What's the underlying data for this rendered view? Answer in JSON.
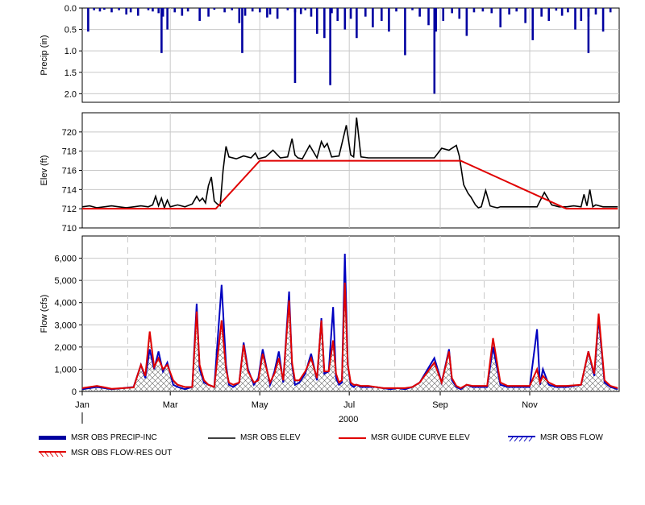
{
  "chart_data": [
    {
      "type": "bar",
      "panel": "precip",
      "ylabel": "Precip (in)",
      "ylim": [
        0,
        2.2
      ],
      "y_inverted": true,
      "yticks": [
        "0.0",
        "0.5",
        "1.0",
        "1.5",
        "2.0"
      ],
      "yticks_values": [
        0,
        0.5,
        1.0,
        1.5,
        2.0
      ],
      "series": [
        {
          "name": "MSR OBS PRECIP-INC",
          "color": "#0000a0",
          "x_day": [
            4,
            8,
            12,
            15,
            20,
            25,
            30,
            33,
            38,
            45,
            48,
            52,
            55,
            58,
            63,
            68,
            72,
            80,
            86,
            90,
            97,
            102,
            107,
            111,
            116,
            121,
            126,
            128,
            133,
            140,
            145,
            149,
            152,
            156,
            160,
            165,
            170,
            174,
            179,
            183,
            187,
            193,
            198,
            204,
            209,
            214,
            220,
            225,
            230,
            236,
            241,
            246,
            252,
            257,
            262,
            267,
            273,
            279,
            285,
            291,
            296,
            302,
            307,
            313,
            318,
            323,
            327,
            331,
            336,
            340,
            345,
            350,
            355,
            360
          ],
          "values": [
            0.55,
            0.05,
            0.08,
            0.04,
            0.1,
            0.05,
            0.15,
            0.1,
            0.18,
            0.05,
            0.08,
            0.12,
            0.2,
            0.5,
            0.1,
            0.18,
            0.08,
            0.3,
            0.2,
            0.04,
            0.1,
            0.05,
            0.35,
            0.18,
            0.08,
            0.1,
            0.22,
            0.15,
            0.25,
            0.05,
            0.1,
            0.14,
            0.05,
            0.2,
            0.6,
            0.7,
            0.12,
            0.3,
            0.5,
            0.25,
            0.7,
            0.2,
            0.45,
            0.3,
            0.55,
            0.08,
            1.1,
            0.05,
            0.2,
            0.4,
            0.55,
            0.3,
            0.12,
            0.25,
            0.65,
            0.1,
            0.08,
            0.12,
            0.45,
            0.15,
            0.08,
            0.35,
            0.75,
            0.2,
            0.3,
            0.06,
            0.18,
            0.1,
            0.5,
            0.3,
            0.2,
            0.15,
            0.55,
            0.1
          ]
        }
      ],
      "extra_bars": [
        {
          "x_day": 54,
          "value": 1.05
        },
        {
          "x_day": 109,
          "value": 1.05
        },
        {
          "x_day": 145,
          "value": 1.75
        },
        {
          "x_day": 169,
          "value": 1.8
        },
        {
          "x_day": 240,
          "value": 2.0
        },
        {
          "x_day": 345,
          "value": 1.05
        }
      ]
    },
    {
      "type": "line",
      "panel": "elev",
      "ylabel": "Elev (ft)",
      "ylim": [
        710,
        722
      ],
      "yticks": [
        "710",
        "712",
        "714",
        "716",
        "718",
        "720"
      ],
      "yticks_values": [
        710,
        712,
        714,
        716,
        718,
        720
      ],
      "series": [
        {
          "name": "MSR OBS ELEV",
          "color": "#000000",
          "x": [
            0,
            5,
            10,
            15,
            20,
            25,
            30,
            35,
            40,
            45,
            48,
            50,
            52,
            54,
            56,
            58,
            60,
            65,
            70,
            75,
            78,
            80,
            82,
            84,
            86,
            88,
            90,
            92,
            94,
            96,
            98,
            100,
            105,
            110,
            115,
            118,
            120,
            125,
            130,
            135,
            140,
            143,
            145,
            147,
            150,
            155,
            160,
            163,
            165,
            167,
            170,
            175,
            180,
            183,
            185,
            187,
            190,
            195,
            200,
            205,
            210,
            215,
            220,
            225,
            230,
            235,
            240,
            245,
            250,
            255,
            257,
            260,
            263,
            265,
            268,
            270,
            272,
            275,
            278,
            280,
            283,
            285,
            290,
            300,
            310,
            315,
            320,
            325,
            330,
            335,
            340,
            342,
            344,
            346,
            348,
            350,
            355,
            360,
            365
          ],
          "y": [
            712.2,
            712.3,
            712.1,
            712.2,
            712.3,
            712.2,
            712.1,
            712.2,
            712.3,
            712.2,
            712.4,
            713.3,
            712.3,
            713.1,
            712.1,
            712.9,
            712.2,
            712.4,
            712.2,
            712.5,
            713.3,
            712.8,
            713.1,
            712.6,
            714.4,
            715.3,
            712.8,
            712.5,
            712.3,
            716.0,
            718.5,
            717.4,
            717.2,
            717.5,
            717.3,
            717.8,
            717.2,
            717.4,
            718.1,
            717.3,
            717.4,
            719.3,
            717.6,
            717.3,
            717.2,
            718.6,
            717.3,
            719.0,
            718.4,
            718.8,
            717.4,
            717.5,
            720.7,
            717.6,
            717.4,
            721.5,
            717.4,
            717.3,
            717.3,
            717.3,
            717.3,
            717.3,
            717.3,
            717.3,
            717.3,
            717.3,
            717.3,
            718.3,
            718.1,
            718.6,
            717.5,
            714.5,
            713.6,
            713.2,
            712.4,
            712.1,
            712.2,
            713.9,
            712.3,
            712.2,
            712.1,
            712.2,
            712.2,
            712.2,
            712.2,
            713.7,
            712.4,
            712.2,
            712.2,
            712.3,
            712.2,
            713.5,
            712.3,
            714.0,
            712.2,
            712.4,
            712.2,
            712.2,
            712.2
          ],
          "x_unit": "day of year 2000"
        },
        {
          "name": "MSR GUIDE CURVE ELEV",
          "color": "#e00000",
          "x": [
            0,
            91,
            121,
            258,
            330,
            365
          ],
          "y": [
            712,
            712,
            717,
            717,
            712,
            712
          ]
        }
      ]
    },
    {
      "type": "area",
      "panel": "flow",
      "ylabel": "Flow (cfs)",
      "ylim": [
        0,
        7000
      ],
      "yticks": [
        "0",
        "1,000",
        "2,000",
        "3,000",
        "4,000",
        "5,000",
        "6,000"
      ],
      "yticks_values": [
        0,
        1000,
        2000,
        3000,
        4000,
        5000,
        6000
      ],
      "xlabel": "2000",
      "xticks": [
        "Jan",
        "Mar",
        "May",
        "Jul",
        "Sep",
        "Nov"
      ],
      "xticks_day": [
        0,
        60,
        121,
        182,
        244,
        305
      ],
      "gridline_days": [
        31,
        91,
        152,
        213,
        274,
        335
      ],
      "series": [
        {
          "name": "MSR OBS FLOW",
          "color": "#0000c0",
          "x": [
            0,
            10,
            20,
            28,
            35,
            40,
            43,
            46,
            49,
            52,
            55,
            58,
            62,
            65,
            70,
            75,
            78,
            80,
            83,
            86,
            90,
            95,
            98,
            100,
            103,
            107,
            110,
            113,
            117,
            120,
            123,
            128,
            131,
            134,
            137,
            141,
            143,
            145,
            148,
            152,
            156,
            160,
            163,
            165,
            168,
            171,
            173,
            175,
            177,
            179,
            181,
            183,
            185,
            187,
            190,
            195,
            200,
            205,
            210,
            215,
            220,
            225,
            230,
            240,
            245,
            250,
            252,
            255,
            258,
            262,
            266,
            270,
            276,
            280,
            285,
            290,
            295,
            300,
            305,
            310,
            312,
            314,
            318,
            323,
            330,
            340,
            345,
            349,
            352,
            356,
            360,
            365
          ],
          "y": [
            100,
            200,
            100,
            150,
            200,
            1200,
            600,
            1900,
            1000,
            1800,
            900,
            1300,
            300,
            200,
            100,
            200,
            3950,
            1000,
            400,
            300,
            200,
            4800,
            1200,
            300,
            200,
            400,
            2200,
            1000,
            300,
            600,
            1900,
            300,
            900,
            1800,
            400,
            4500,
            1200,
            300,
            400,
            800,
            1700,
            500,
            3300,
            800,
            900,
            3800,
            600,
            300,
            400,
            6200,
            1200,
            300,
            200,
            300,
            200,
            200,
            200,
            150,
            100,
            150,
            100,
            200,
            400,
            1500,
            400,
            1900,
            500,
            200,
            100,
            300,
            200,
            200,
            200,
            2000,
            300,
            200,
            200,
            200,
            200,
            2800,
            300,
            1000,
            300,
            200,
            200,
            300,
            1800,
            700,
            3300,
            400,
            200,
            100
          ]
        },
        {
          "name": "MSR OBS FLOW-RES OUT",
          "color": "#e00000",
          "x": [
            0,
            10,
            20,
            28,
            35,
            40,
            43,
            46,
            49,
            52,
            55,
            58,
            62,
            65,
            70,
            75,
            78,
            80,
            83,
            86,
            90,
            95,
            98,
            100,
            103,
            107,
            110,
            113,
            117,
            120,
            123,
            128,
            131,
            134,
            137,
            141,
            143,
            145,
            148,
            152,
            156,
            160,
            163,
            165,
            168,
            171,
            173,
            175,
            177,
            179,
            181,
            183,
            185,
            187,
            190,
            195,
            200,
            205,
            210,
            215,
            220,
            225,
            230,
            240,
            245,
            250,
            252,
            255,
            258,
            262,
            266,
            270,
            276,
            280,
            285,
            290,
            295,
            300,
            305,
            310,
            312,
            314,
            318,
            323,
            330,
            340,
            345,
            349,
            352,
            356,
            360,
            365
          ],
          "y": [
            150,
            250,
            120,
            150,
            180,
            1200,
            700,
            2700,
            1100,
            1500,
            1000,
            1200,
            500,
            300,
            200,
            200,
            3600,
            1200,
            500,
            300,
            200,
            3200,
            1000,
            400,
            300,
            400,
            2100,
            900,
            400,
            500,
            1700,
            400,
            800,
            1500,
            500,
            4100,
            1300,
            500,
            500,
            900,
            1500,
            600,
            3200,
            900,
            900,
            2300,
            800,
            400,
            500,
            4900,
            1200,
            400,
            300,
            300,
            250,
            250,
            200,
            150,
            150,
            150,
            150,
            200,
            400,
            1300,
            400,
            1800,
            600,
            250,
            150,
            300,
            250,
            250,
            250,
            2400,
            400,
            250,
            250,
            250,
            250,
            1000,
            400,
            700,
            400,
            250,
            250,
            300,
            1800,
            800,
            3500,
            500,
            250,
            150
          ]
        }
      ]
    }
  ],
  "legend": [
    {
      "label": "MSR OBS PRECIP-INC",
      "style": "thick-bar",
      "color": "#0000a0"
    },
    {
      "label": "MSR OBS ELEV",
      "style": "line",
      "color": "#000000"
    },
    {
      "label": "MSR GUIDE CURVE ELEV",
      "style": "line",
      "color": "#e00000"
    },
    {
      "label": "MSR OBS FLOW",
      "style": "hatched-line",
      "color": "#0000c0"
    },
    {
      "label": "MSR OBS FLOW-RES OUT",
      "style": "hatched-line",
      "color": "#e00000"
    }
  ]
}
